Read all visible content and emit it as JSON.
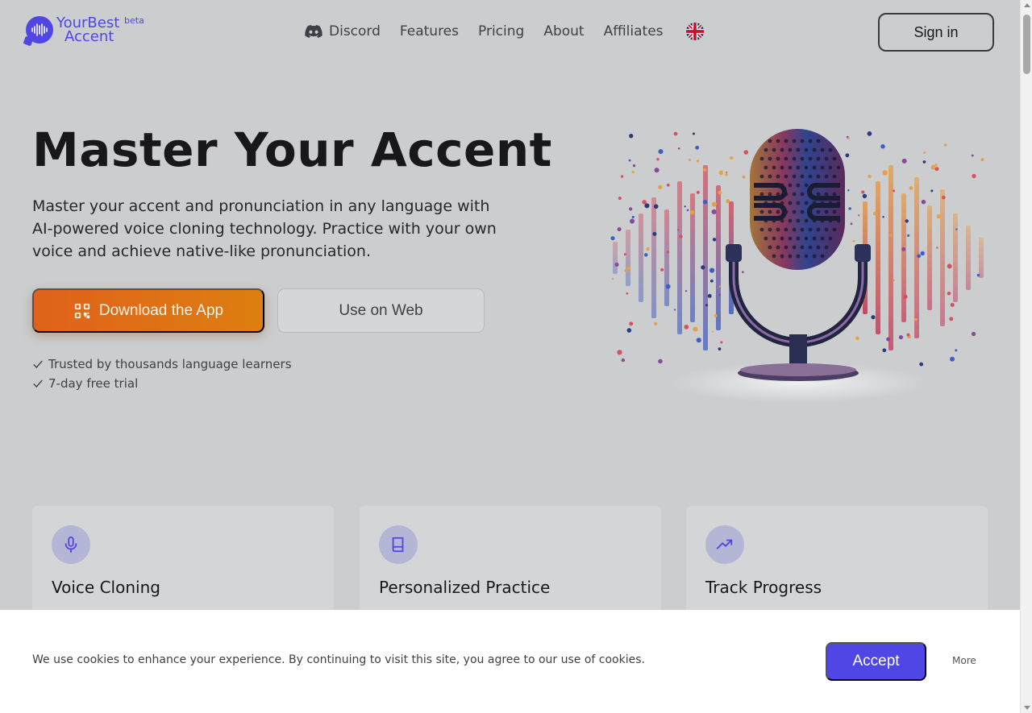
{
  "header": {
    "logo_line1": "YourBest",
    "logo_line2": "Accent",
    "logo_badge": "beta",
    "nav": [
      {
        "label": "Discord",
        "icon": "discord-icon"
      },
      {
        "label": "Features"
      },
      {
        "label": "Pricing"
      },
      {
        "label": "About"
      },
      {
        "label": "Affiliates"
      }
    ],
    "language_icon": "uk-flag-icon",
    "signin_label": "Sign in"
  },
  "hero": {
    "title": "Master Your Accent",
    "subtitle": "Master your accent and pronunciation in any language with AI-powered voice cloning technology. Practice with your own voice and achieve native-like pronunciation.",
    "download_label": "Download the App",
    "web_label": "Use on Web",
    "trust": [
      "Trusted by thousands language learners",
      "7-day free trial"
    ]
  },
  "features": [
    {
      "title": "Voice Cloning",
      "icon": "microphone-icon"
    },
    {
      "title": "Personalized Practice",
      "icon": "book-icon"
    },
    {
      "title": "Track Progress",
      "icon": "trending-up-icon"
    }
  ],
  "cookie": {
    "text": "We use cookies to enhance your experience. By continuing to visit this site, you agree to our use of cookies.",
    "accept_label": "Accept",
    "more_label": "More"
  },
  "colors": {
    "brand": "#4f46e5",
    "download_start": "#e0611b",
    "download_end": "#dd7f10",
    "background": "#cbcdcf"
  }
}
